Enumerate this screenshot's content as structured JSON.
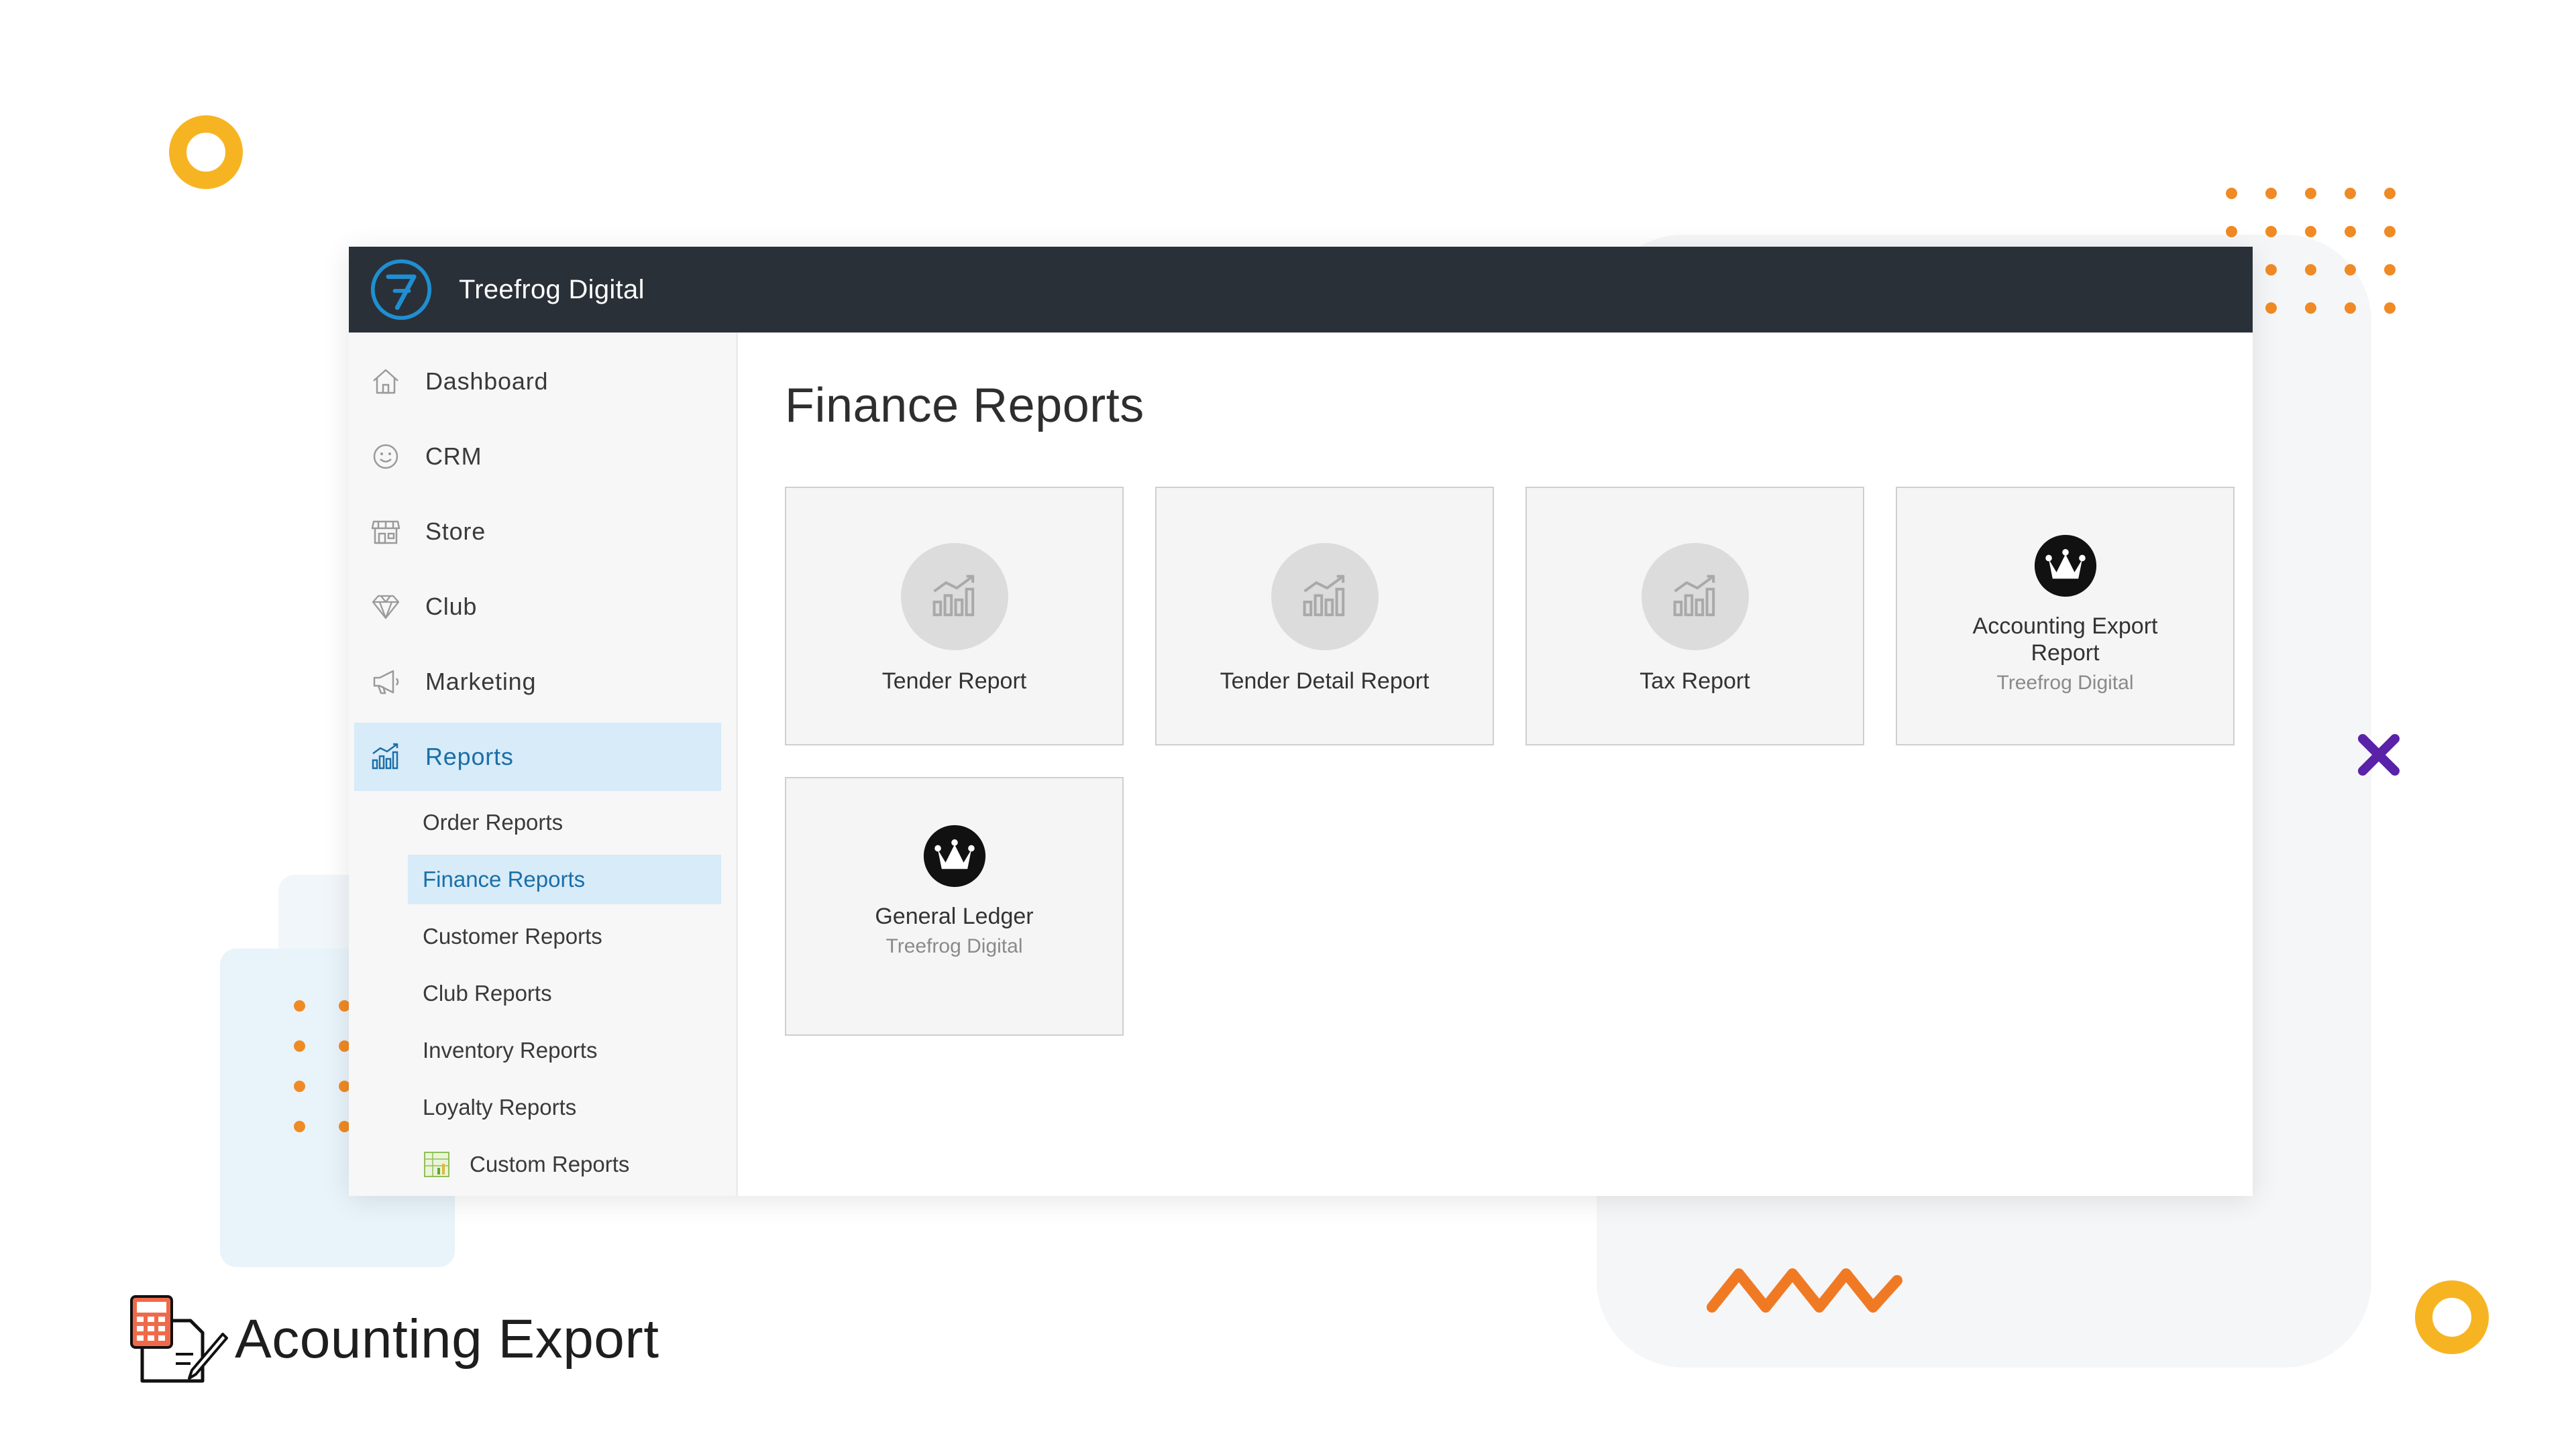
{
  "app": {
    "brand": "Treefrog Digital",
    "logo_icon": "treefrog-seven-logo",
    "brand_color": "#2a3038",
    "accent_color": "#1a6fa8"
  },
  "sidebar": {
    "items": [
      {
        "label": "Dashboard",
        "icon": "home-icon"
      },
      {
        "label": "CRM",
        "icon": "smiley-face-icon"
      },
      {
        "label": "Store",
        "icon": "storefront-icon"
      },
      {
        "label": "Club",
        "icon": "diamond-icon"
      },
      {
        "label": "Marketing",
        "icon": "megaphone-icon"
      },
      {
        "label": "Reports",
        "icon": "bar-chart-icon",
        "active": true
      }
    ],
    "sub_items": [
      {
        "label": "Order Reports"
      },
      {
        "label": "Finance Reports",
        "active": true
      },
      {
        "label": "Customer Reports"
      },
      {
        "label": "Club Reports"
      },
      {
        "label": "Inventory Reports"
      },
      {
        "label": "Loyalty Reports"
      },
      {
        "label": "Custom Reports",
        "icon": "spreadsheet-icon"
      }
    ]
  },
  "main": {
    "title": "Finance Reports",
    "cards": [
      {
        "label": "Tender Report",
        "icon": "bar-chart-icon"
      },
      {
        "label": "Tender Detail Report",
        "icon": "bar-chart-icon"
      },
      {
        "label": "Tax Report",
        "icon": "bar-chart-icon"
      },
      {
        "label": "Accounting Export Report",
        "vendor": "Treefrog Digital",
        "icon": "crown-logo-icon"
      },
      {
        "label": "General Ledger",
        "vendor": "Treefrog Digital",
        "icon": "crown-logo-icon"
      }
    ]
  },
  "caption": {
    "text": "Acounting Export",
    "icon": "calculator-document-icon"
  },
  "colors": {
    "decor_orange": "#f08a24",
    "decor_yellow": "#f7b422",
    "decor_purple": "#5a22a8",
    "active_bg": "#d7ebf8"
  }
}
